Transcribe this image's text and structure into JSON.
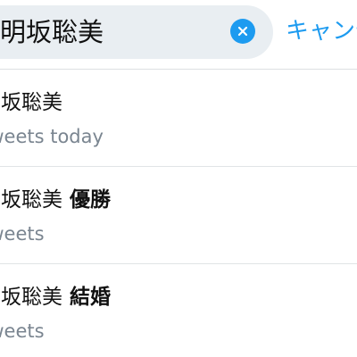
{
  "search": {
    "query": "明坂聡美",
    "cancel_label": "キャンセル"
  },
  "suggestions": [
    {
      "title": "明坂聡美",
      "bold": "",
      "subtitle": "Tweets today"
    },
    {
      "title": "明坂聡美",
      "bold": "優勝",
      "subtitle": "Tweets"
    },
    {
      "title": "明坂聡美",
      "bold": "結婚",
      "subtitle": "Tweets"
    }
  ],
  "colors": {
    "accent": "#1d9bf0",
    "field_bg": "#e9eef2",
    "secondary_text": "#7a8590"
  },
  "icons": {
    "clear": "close-circle-icon"
  }
}
